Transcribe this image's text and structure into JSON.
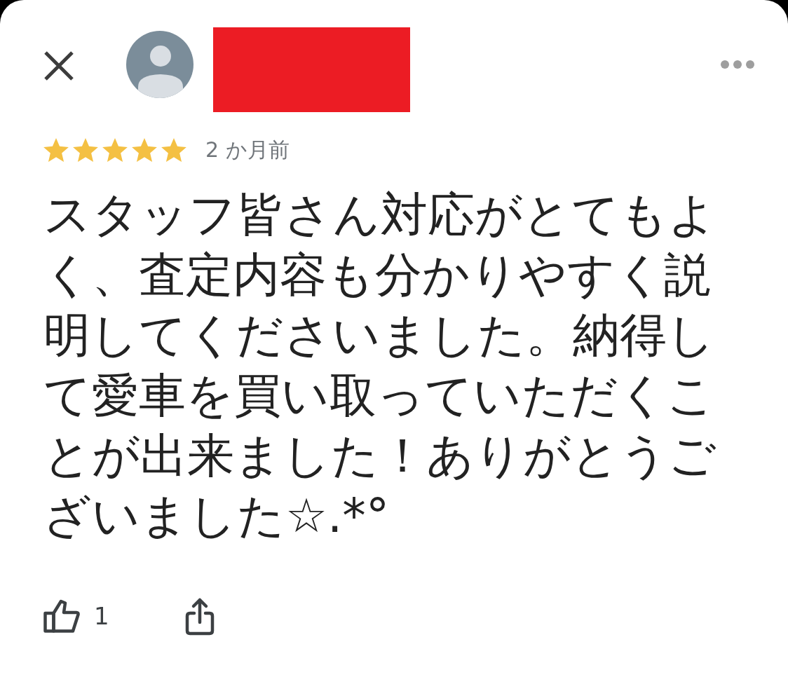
{
  "review": {
    "stars": 5,
    "time": "2 か月前",
    "text": "スタッフ皆さん対応がとてもよく、査定内容も分かりやすく説明してくださいました。納得して愛車を買い取っていただくことが出来ました！ありがとうございました☆.*°"
  },
  "actions": {
    "like_count": "1"
  }
}
